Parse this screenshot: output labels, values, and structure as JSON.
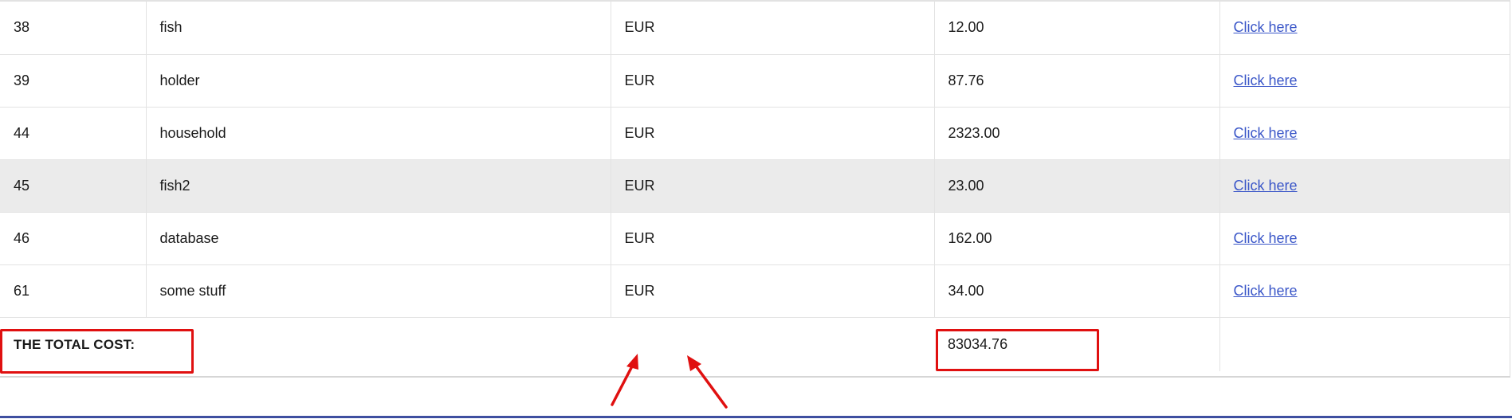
{
  "table": {
    "rows": [
      {
        "id": "38",
        "name": "fish",
        "currency": "EUR",
        "amount": "12.00",
        "link": "Click here"
      },
      {
        "id": "39",
        "name": "holder",
        "currency": "EUR",
        "amount": "87.76",
        "link": "Click here"
      },
      {
        "id": "44",
        "name": "household",
        "currency": "EUR",
        "amount": "2323.00",
        "link": "Click here"
      },
      {
        "id": "45",
        "name": "fish2",
        "currency": "EUR",
        "amount": "23.00",
        "link": "Click here"
      },
      {
        "id": "46",
        "name": "database",
        "currency": "EUR",
        "amount": "162.00",
        "link": "Click here"
      },
      {
        "id": "61",
        "name": "some stuff",
        "currency": "EUR",
        "amount": "34.00",
        "link": "Click here"
      }
    ],
    "highlighted_row_index": 3,
    "total_label": "THE TOTAL COST:",
    "total_value": "83034.76"
  },
  "colors": {
    "annotation": "#e01010",
    "link": "#3a56c8",
    "highlight_row": "#ebebeb",
    "bottom_bar": "#3f4fa0"
  }
}
